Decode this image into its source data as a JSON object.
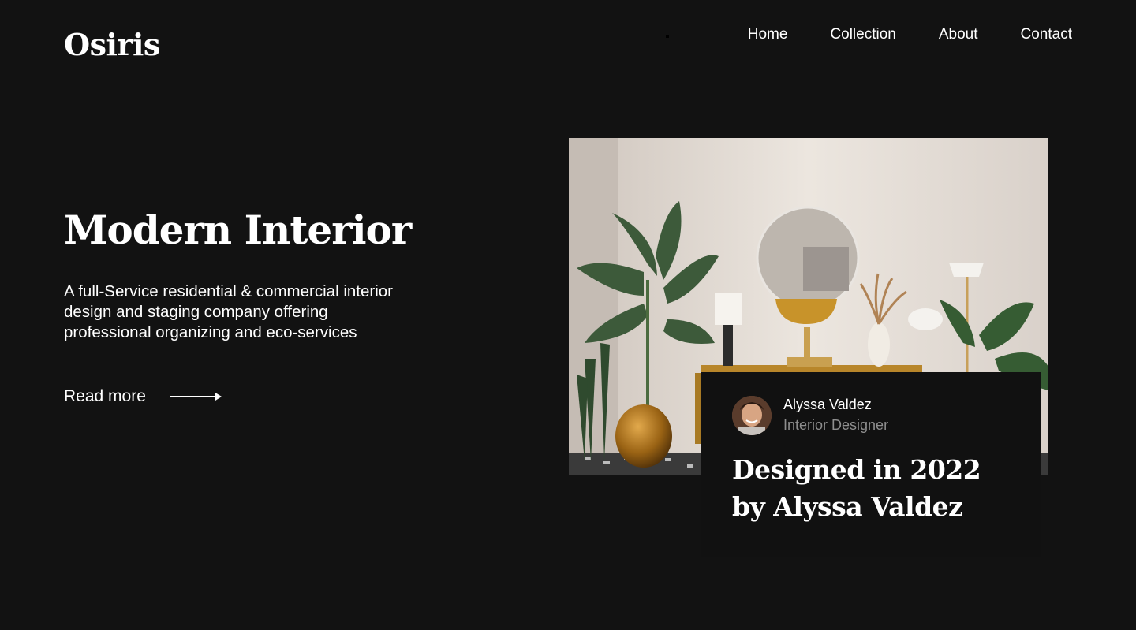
{
  "header": {
    "logo": "Osiris",
    "nav": [
      {
        "label": "Home"
      },
      {
        "label": "Collection"
      },
      {
        "label": "About"
      },
      {
        "label": "Contact"
      }
    ]
  },
  "hero": {
    "title": "Modern Interior",
    "description": "A full-Service residential & commercial interior design and staging company offering professional organizing and eco-services",
    "cta_label": "Read more",
    "cta_icon": "arrow-right-icon"
  },
  "feature": {
    "image": "interior-room-photo",
    "author_name": "Alyssa Valdez",
    "author_role": "Interior Designer",
    "title": "Designed in 2022 by Alyssa Valdez"
  },
  "colors": {
    "background": "#121212",
    "card": "#111111",
    "text": "#ffffff",
    "muted": "#8e8e8e"
  }
}
